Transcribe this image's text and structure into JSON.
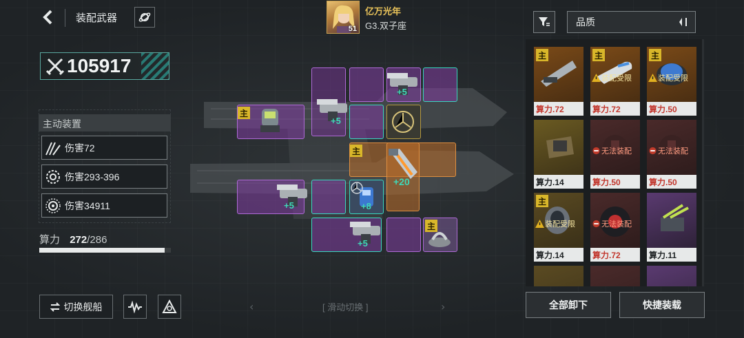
{
  "header": {
    "back_icon": "back-arrow-icon",
    "title": "装配武器",
    "planet_icon": "planet-icon",
    "player_name": "亿万光年",
    "player_level": "51",
    "player_rank": "G3.双子座"
  },
  "left": {
    "power_value": "105917",
    "section_title": "主动装置",
    "skills": [
      {
        "icon": "slash-icon",
        "label": "伤害72"
      },
      {
        "icon": "gear-target-icon",
        "label": "伤害293-396"
      },
      {
        "icon": "gear-ring-icon",
        "label": "伤害34911"
      }
    ],
    "capacity_label": "算力",
    "capacity_used": "272",
    "capacity_total": "/286",
    "capacity_fraction": 0.951,
    "switch_ship_label": "切换舰船"
  },
  "grid": {
    "swipe_label": "滑动切换",
    "main_badge": "主",
    "plus5": "+5",
    "plus8": "+8",
    "plus20": "+20"
  },
  "right": {
    "filter_icon": "filter-icon",
    "sort_label": "品质",
    "sort_icon": "sort-icon",
    "cards": [
      {
        "badge": "主",
        "warn": "",
        "cost": "算力.72",
        "cost_color": "red"
      },
      {
        "badge": "主",
        "warn": "装配受限",
        "cost": "算力.72",
        "cost_color": "red"
      },
      {
        "badge": "主",
        "warn": "装配受限",
        "cost": "算力.50",
        "cost_color": "red"
      },
      {
        "badge": "",
        "warn": "",
        "cost": "算力.14",
        "cost_color": "dark"
      },
      {
        "badge": "",
        "warn": "无法装配",
        "cost": "算力.50",
        "cost_color": "red"
      },
      {
        "badge": "",
        "warn": "无法装配",
        "cost": "算力.50",
        "cost_color": "red"
      },
      {
        "badge": "主",
        "warn": "装配受限",
        "cost": "算力.14",
        "cost_color": "dark"
      },
      {
        "badge": "",
        "warn": "无法装配",
        "cost": "算力.72",
        "cost_color": "red"
      },
      {
        "badge": "",
        "warn": "",
        "cost": "算力.11",
        "cost_color": "dark"
      }
    ],
    "unequip_all": "全部卸下",
    "quick_equip": "快捷装载"
  }
}
